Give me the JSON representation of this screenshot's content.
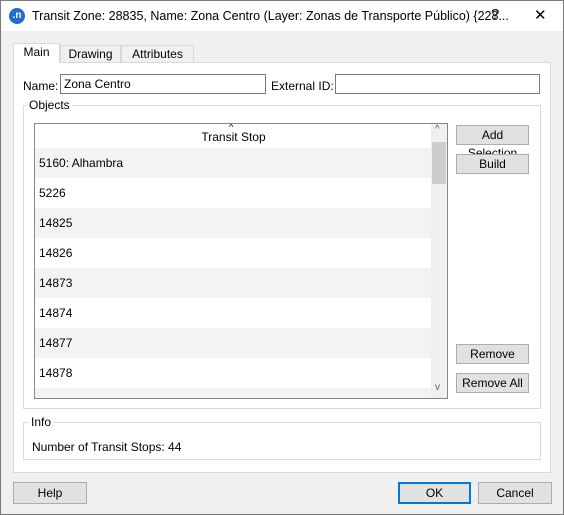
{
  "window": {
    "title": "Transit Zone: 28835, Name: Zona Centro (Layer: Zonas de Transporte Público) {228...",
    "help_glyph": "?",
    "close_glyph": "✕",
    "app_icon_text": ".n"
  },
  "tabs": [
    {
      "label": "Main",
      "active": true
    },
    {
      "label": "Drawing"
    },
    {
      "label": "Attributes"
    }
  ],
  "main": {
    "name_label": "Name:",
    "name_value": "Zona Centro",
    "external_id_label": "External ID:",
    "external_id_value": "",
    "objects_label": "Objects",
    "list_header": "Transit Stop",
    "rows": [
      "5160: Alhambra",
      "5226",
      "14825",
      "14826",
      "14873",
      "14874",
      "14877",
      "14878"
    ],
    "buttons": {
      "add_selection": "Add Selection",
      "build": "Build",
      "remove": "Remove",
      "remove_all": "Remove All"
    },
    "info_label": "Info",
    "info_text": "Number of Transit Stops: 44"
  },
  "footer": {
    "help": "Help",
    "ok": "OK",
    "cancel": "Cancel"
  }
}
